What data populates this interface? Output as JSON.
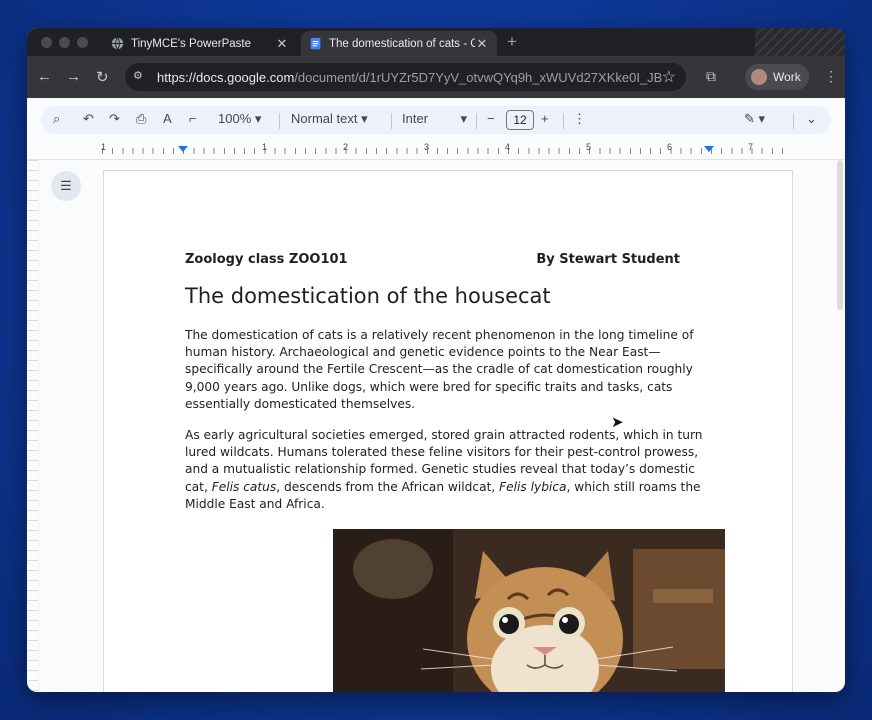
{
  "browser": {
    "tabs": [
      {
        "title": "TinyMCE's PowerPaste",
        "active": false
      },
      {
        "title": "The domestication of cats - G",
        "active": true
      }
    ],
    "url_host": "https://docs.google.com",
    "url_path": "/document/d/1rUYZr5D7YyV_otvwQYq9h_xWUVd27XKke0I_JB...",
    "profile_label": "Work"
  },
  "toolbar": {
    "zoom": "100%",
    "style": "Normal text",
    "font": "Inter",
    "font_size": "12"
  },
  "ruler": {
    "numbers": [
      "1",
      "1",
      "2",
      "3",
      "4",
      "5",
      "6",
      "7"
    ]
  },
  "document": {
    "header_left": "Zoology class ZOO101",
    "header_right": "By Stewart Student",
    "title": "The domestication of the housecat",
    "paragraph1": "The domestication of cats is a relatively recent phenomenon in the long timeline of human history. Archaeological and genetic evidence points to the Near East—specifically around the Fertile Crescent—as the cradle of cat domestication roughly 9,000 years ago. Unlike dogs, which were bred for specific traits and tasks, cats essentially domesticated themselves.",
    "paragraph2_a": "As early agricultural societies emerged, stored grain attracted rodents, which in turn lured wildcats. Humans tolerated these feline visitors for their pest-control prowess, and a mutualistic relationship formed. Genetic studies reveal that today’s domestic cat, ",
    "paragraph2_b": "Felis catus",
    "paragraph2_c": ", descends from the African wildcat, ",
    "paragraph2_d": "Felis lybica",
    "paragraph2_e": ", which still roams the Middle East and Africa."
  },
  "colors": {
    "accent": "#1a73e8",
    "toolbar_bg": "#edf2fa",
    "chrome_dark": "#202124"
  }
}
